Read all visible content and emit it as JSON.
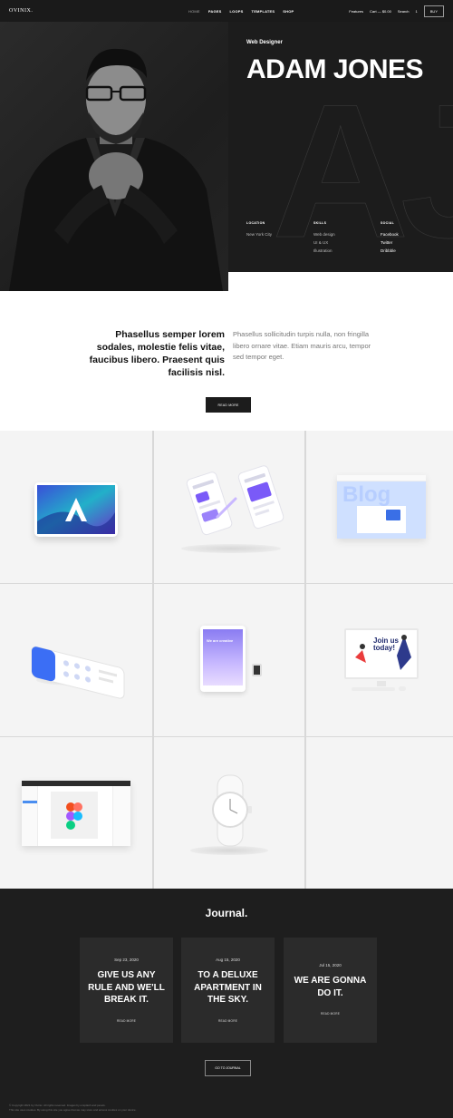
{
  "nav": {
    "logo": "OVINIX.",
    "links": [
      "HOME",
      "PAGES",
      "LOOPS",
      "TEMPLATES",
      "SHOP"
    ],
    "features": "Features",
    "cart": "Cart — $0.00",
    "search": "Search",
    "count": "1",
    "buy": "BUY"
  },
  "hero": {
    "role": "Web Designer",
    "name": "ADAM JONES",
    "bg_letters": "AJ",
    "location": {
      "title": "LOCATION",
      "items": [
        "New York City"
      ]
    },
    "skills": {
      "title": "SKILLS",
      "items": [
        "Web design",
        "UI & UX",
        "Illustration"
      ]
    },
    "social": {
      "title": "SOCIAL",
      "items": [
        "Facebook",
        "Twitter",
        "Dribbble"
      ]
    }
  },
  "intro": {
    "left": "Phasellus semper lorem sodales, molestie felis vitae, faucibus libero. Praesent quis facilisis nisl.",
    "right": "Phasellus sollicitudin turpis nulla, non fringilla libero ornare vitae. Etiam mauris arcu, tempor sed tempor eget.",
    "button": "READ MORE"
  },
  "portfolio": {
    "blog_word": "Blog",
    "join_us": "Join us today!",
    "cta": "We are creative"
  },
  "journal": {
    "title": "Journal.",
    "posts": [
      {
        "date": "Sep 23, 2020",
        "title": "GIVE US ANY RULE AND WE'LL BREAK IT.",
        "more": "READ MORE"
      },
      {
        "date": "Aug 15, 2020",
        "title": "TO A DELUXE APARTMENT IN THE SKY.",
        "more": "READ MORE"
      },
      {
        "date": "Jul 15, 2020",
        "title": "WE ARE GONNA DO IT.",
        "more": "READ MORE"
      }
    ],
    "button": "GO TO JOURNAL",
    "footer1": "© Copyright 2021 by Ovinix. All rights reserved. Images by unsplash and pexels.",
    "footer2": "This site uses cookies. By using this site you agree that we may store and access cookies on your device."
  }
}
